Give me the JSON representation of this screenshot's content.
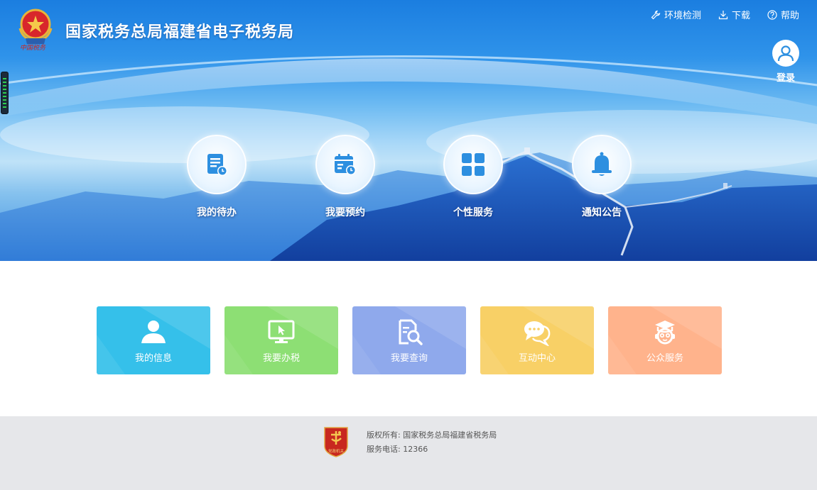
{
  "header": {
    "title": "国家税务总局福建省电子税务局",
    "logo_script": "中国税务",
    "links": [
      {
        "label": "环境检测",
        "icon": "wrench-icon"
      },
      {
        "label": "下载",
        "icon": "download-icon"
      },
      {
        "label": "帮助",
        "icon": "help-icon"
      }
    ],
    "login_label": "登录"
  },
  "quick_entries": [
    {
      "label": "我的待办",
      "icon": "todo-document-icon"
    },
    {
      "label": "我要预约",
      "icon": "calendar-clock-icon"
    },
    {
      "label": "个性服务",
      "icon": "grid-icon"
    },
    {
      "label": "通知公告",
      "icon": "bell-icon"
    }
  ],
  "tiles": [
    {
      "label": "我的信息",
      "icon": "user-icon",
      "color": "#35c0ea"
    },
    {
      "label": "我要办税",
      "icon": "monitor-cursor-icon",
      "color": "#8ddf74"
    },
    {
      "label": "我要查询",
      "icon": "document-search-icon",
      "color": "#8fa9ec"
    },
    {
      "label": "互动中心",
      "icon": "chat-bubbles-icon",
      "color": "#f8d066"
    },
    {
      "label": "公众服务",
      "icon": "graduate-icon",
      "color": "#ffb38c"
    }
  ],
  "footer": {
    "badge_text": "党政机关",
    "copyright": "版权所有: 国家税务总局福建省税务局",
    "phone": "服务电话: 12366"
  },
  "colors": {
    "hero_blue": "#1b7ee0",
    "icon_blue": "#2d8fe0",
    "footer_bg": "#e6e7ea"
  }
}
